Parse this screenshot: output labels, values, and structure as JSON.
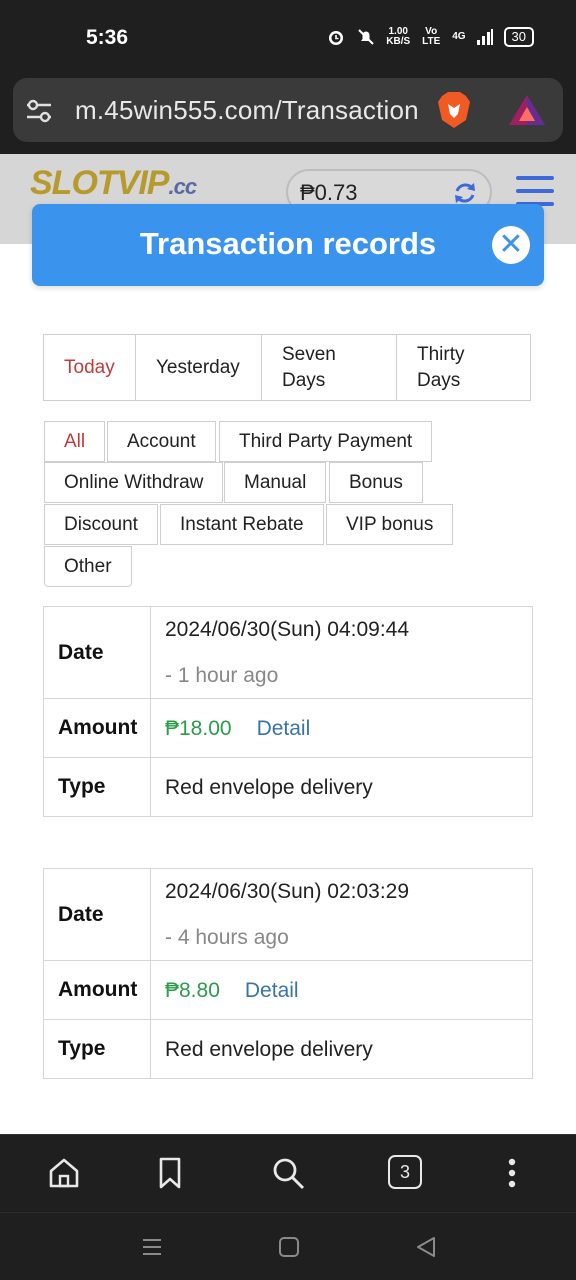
{
  "status_bar": {
    "time": "5:36",
    "net_speed": "1.00",
    "net_unit": "KB/S",
    "volte": "Vo LTE",
    "network": "4G",
    "battery": "30"
  },
  "browser": {
    "url": "m.45win555.com/Transaction",
    "tab_count": "3"
  },
  "site": {
    "logo_text": "SLOTVIP",
    "logo_suffix": ".cc",
    "balance": "₱0.73"
  },
  "modal": {
    "title": "Transaction records",
    "date_tabs": [
      {
        "label": "Today",
        "active": true
      },
      {
        "label": "Yesterday",
        "active": false
      },
      {
        "label": "Seven Days",
        "active": false
      },
      {
        "label": "Thirty Days",
        "active": false
      }
    ],
    "type_chips": [
      {
        "label": "All"
      },
      {
        "label": "Account"
      },
      {
        "label": "Third Party Payment"
      },
      {
        "label": "Online Withdraw"
      },
      {
        "label": "Manual"
      },
      {
        "label": "Bonus"
      },
      {
        "label": "Discount"
      },
      {
        "label": "Instant Rebate"
      },
      {
        "label": "VIP bonus"
      },
      {
        "label": "Other"
      }
    ],
    "labels": {
      "date": "Date",
      "amount": "Amount",
      "type": "Type",
      "detail": "Detail"
    },
    "records": [
      {
        "date": "2024/06/30(Sun) 04:09:44",
        "relative": "- 1 hour ago",
        "amount": "₱18.00",
        "type": "Red envelope delivery"
      },
      {
        "date": "2024/06/30(Sun) 02:03:29",
        "relative": "- 4 hours ago",
        "amount": "₱8.80",
        "type": "Red envelope delivery"
      }
    ]
  },
  "colors": {
    "modal_header": "#3a93ec",
    "active_tab": "#c23b3b",
    "amount": "#2a9d4b",
    "detail_link": "#3874a8"
  }
}
